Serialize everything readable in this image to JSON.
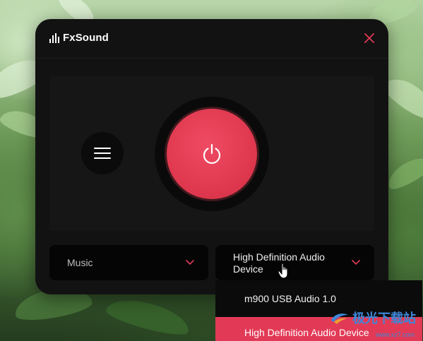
{
  "app": {
    "title": "FxSound",
    "accent_color": "#e23a56",
    "close_icon": "close-icon",
    "menu_icon": "hamburger-menu-icon",
    "power_icon": "power-icon",
    "power_state": "on"
  },
  "controls": {
    "preset": {
      "selected": "Music"
    },
    "output_device": {
      "selected": "High Definition Audio Device"
    }
  },
  "device_menu": {
    "items": [
      {
        "label": "m900 USB Audio 1.0",
        "highlighted": false
      },
      {
        "label": "High Definition Audio Device",
        "highlighted": true
      }
    ]
  },
  "watermark": {
    "text": "极光下载站",
    "url": "www.xz7.com"
  }
}
